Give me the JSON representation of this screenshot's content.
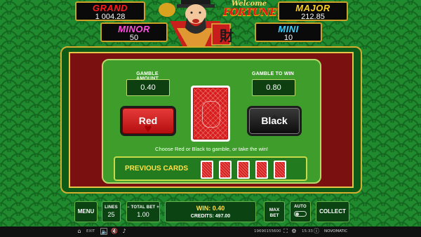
{
  "jackpots": {
    "grand": {
      "label": "GRAND",
      "value": "1 004.28"
    },
    "major": {
      "label": "MAJOR",
      "value": "212.85"
    },
    "minor": {
      "label": "MINOR",
      "value": "50"
    },
    "mini": {
      "label": "MINI",
      "value": "10"
    }
  },
  "logo": {
    "line1": "Welcome",
    "line2": "FORTUNE",
    "glyph": "財"
  },
  "gamble": {
    "amount_label": "GAMBLE AMOUNT",
    "amount_value": "0.40",
    "to_win_label": "GAMBLE TO WIN",
    "to_win_value": "0.80",
    "red_label": "Red",
    "black_label": "Black",
    "hint": "Choose Red or Black to gamble, or take the win!",
    "previous_cards_label": "PREVIOUS CARDS",
    "previous_cards_count": 5
  },
  "controls": {
    "menu": "MENU",
    "lines_label": "LINES",
    "lines_value": "25",
    "minus": "−",
    "total_bet_label": "TOTAL BET",
    "plus": "+",
    "total_bet_value": "1.00",
    "win": "WIN: 0.40",
    "credits": "CREDITS: 497.00",
    "max_bet_line1": "MAX",
    "max_bet_line2": "BET",
    "auto_label": "AUTO",
    "collect": "COLLECT"
  },
  "status": {
    "exit": "EXIT",
    "session_id": "19690155600",
    "clock": "15:33",
    "brand": "NOVOMATIC"
  },
  "colors": {
    "background": "#1f8a2e",
    "frame_gold": "#d4ae2e",
    "red_button": "#c71818",
    "black_button": "#1a1a1a",
    "win_text": "#ffe14a"
  }
}
